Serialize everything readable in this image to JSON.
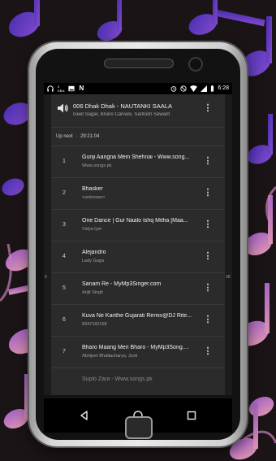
{
  "status_bar": {
    "speed": "0\nKB/s",
    "carrier_icon": "N",
    "time": "6:28"
  },
  "now_playing": {
    "title": "006 Dhak Dhak - NAUTANKI SAALA",
    "artists": "Geet Sagar, Bruno Carvalo, Santosh Sawant",
    "icon": "speaker-icon"
  },
  "up_next": {
    "label": "Up next",
    "separator": "·",
    "duration": "29:21:04"
  },
  "queue": [
    {
      "number": "1",
      "title": "Gunji Aangna Mein Shehnai - Www.song...",
      "subtitle": "Www.songs.pk"
    },
    {
      "number": "2",
      "title": "Bhasker",
      "subtitle": "<unknown>"
    },
    {
      "number": "3",
      "title": "One Dance | Gur Naalo Ishq Mitha [Maa...",
      "subtitle": "Vidya Iyer"
    },
    {
      "number": "4",
      "title": "Alejandro",
      "subtitle": "Lady Gaga"
    },
    {
      "number": "5",
      "title": "Sanam Re - MyMp3Singer.com",
      "subtitle": "Arijit Singh"
    },
    {
      "number": "6",
      "title": "Kuva Ne Kanthe Gujarati Remix@DJ Rite...",
      "subtitle": "8347182158"
    },
    {
      "number": "7",
      "title": "Bharo Maang Meri Bharo - MyMp3Song....",
      "subtitle": "Abhijeet Bhattacharya, Jyoti"
    },
    {
      "number": "",
      "title": "Suplo Zara - Www.songs.pk",
      "subtitle": ""
    }
  ],
  "side_numbers": {
    "left": "0",
    "right": "28"
  },
  "nav": {
    "back": "back-icon",
    "home": "home-icon",
    "recents": "recents-icon"
  },
  "colors": {
    "accent_purple": "#7b45d6",
    "accent_pink": "#d46a9c",
    "background": "#1b1417"
  }
}
